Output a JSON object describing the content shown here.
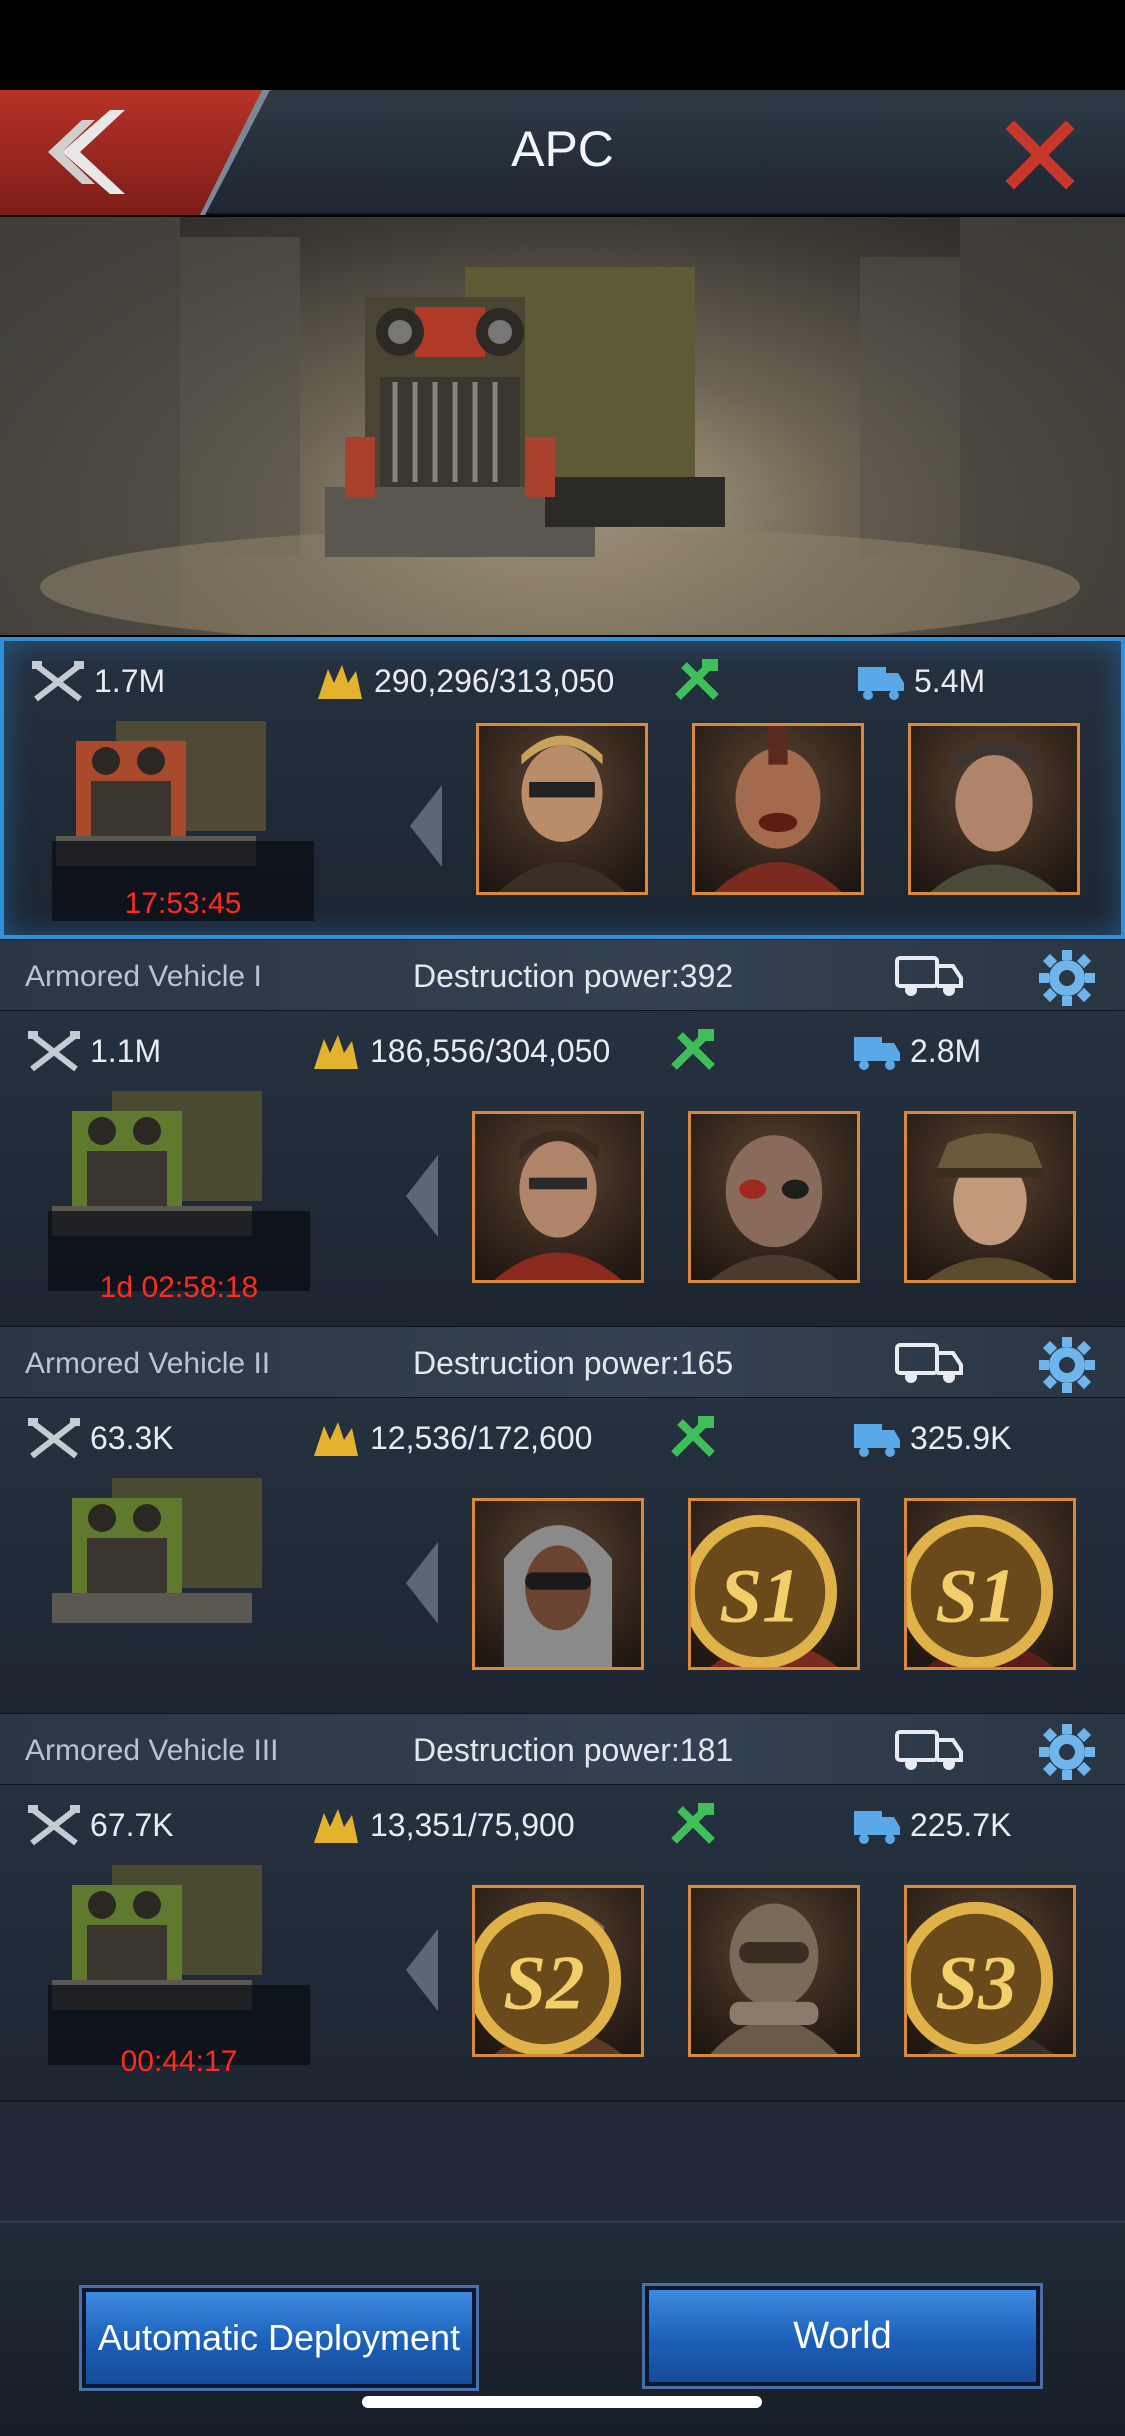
{
  "header": {
    "title": "APC"
  },
  "vehicles": [
    {
      "power": "1.7M",
      "troops": "290,296/313,050",
      "load": "5.4M",
      "timer": "17:53:45",
      "selected": true
    },
    {
      "power": "1.1M",
      "troops": "186,556/304,050",
      "load": "2.8M",
      "timer": "1d 02:58:18"
    },
    {
      "power": "63.3K",
      "troops": "12,536/172,600",
      "load": "325.9K"
    },
    {
      "power": "67.7K",
      "troops": "13,351/75,900",
      "load": "225.7K",
      "timer": "00:44:17"
    }
  ],
  "separators": [
    {
      "name": "Armored Vehicle I",
      "destruction": "Destruction power:392"
    },
    {
      "name": "Armored Vehicle II",
      "destruction": "Destruction power:165"
    },
    {
      "name": "Armored Vehicle III",
      "destruction": "Destruction power:181"
    }
  ],
  "season_badges": [
    "S1",
    "S1",
    "S2",
    "S3"
  ],
  "footer": {
    "auto_label": "Automatic Deployment",
    "world_label": "World"
  },
  "colors": {
    "accent_blue": "#2f8fd8",
    "timer_red": "#ff2a20",
    "hero_frame": "#d88a3a",
    "button_blue": "#1c5fb8"
  },
  "icons": [
    "back-icon",
    "close-icon",
    "crossed-rifles-icon",
    "troops-icon",
    "hammer-wrench-icon",
    "truck-load-icon",
    "truck-icon",
    "gear-icon",
    "chevron-left-icon"
  ]
}
